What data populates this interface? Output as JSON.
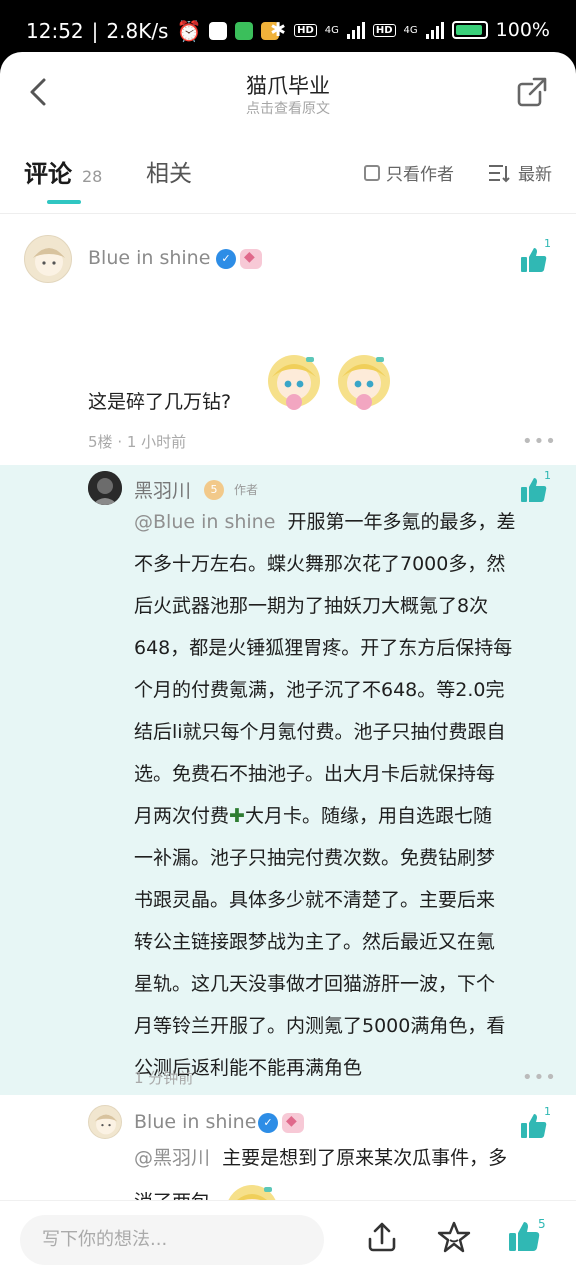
{
  "status": {
    "time": "12:52",
    "net_speed": "2.8K/s",
    "hd1": "HD",
    "sig1": "4G",
    "hd2": "HD",
    "sig2": "4G",
    "battery": "100%"
  },
  "header": {
    "title": "猫爪毕业",
    "subtitle": "点击查看原文"
  },
  "tabs": {
    "comments_label": "评论",
    "comments_count": "28",
    "related_label": "相关",
    "only_author_label": "只看作者",
    "sort_label": "最新"
  },
  "comments": [
    {
      "user": "Blue in shine",
      "text": "这是碎了几万钻?",
      "floor": "5楼",
      "time": "1 小时前",
      "likes": "1"
    }
  ],
  "replies": [
    {
      "user": "黑羽川",
      "level": "5",
      "author_tag": "作者",
      "mention": "@Blue in shine",
      "lines": [
        "开服第一年多氪的最多，差",
        "不多十万左右。蝶火舞那次花了7000多，然",
        "后火武器池那一期为了抽妖刀大概氪了8次",
        "648，都是火锤狐狸胃疼。开了东方后保持每",
        "个月的付费氪满，池子沉了不648。等2.0完",
        "结后li就只每个月氪付费。池子只抽付费跟自",
        "选。免费石不抽池子。出大月卡后就保持每",
        "月两次付费",
        "大月卡。随缘，用自选跟七随",
        "一补漏。池子只抽完付费次数。免费钻刷梦",
        "书跟灵晶。具体多少就不清楚了。主要后来",
        "转公主链接跟梦战为主了。然后最近又在氪",
        "星轨。这几天没事做才回猫游肝一波，下个",
        "月等铃兰开服了。内测氪了5000满角色，看",
        "公测后返利能不能再满角色"
      ],
      "plus_icon": "plus-emoji-icon",
      "time": "1 分钟前",
      "likes": "1"
    },
    {
      "user": "Blue in shine",
      "mention": "@黑羽川",
      "text": "主要是想到了原来某次瓜事件，多",
      "text_cut": "消了两包",
      "likes": "1"
    }
  ],
  "bottom": {
    "input_placeholder": "写下你的想法...",
    "like_count": "5"
  },
  "colors": {
    "accent": "#30c6c2",
    "like_green": "#30b8b4",
    "reply_bg": "#e7f6f5"
  }
}
